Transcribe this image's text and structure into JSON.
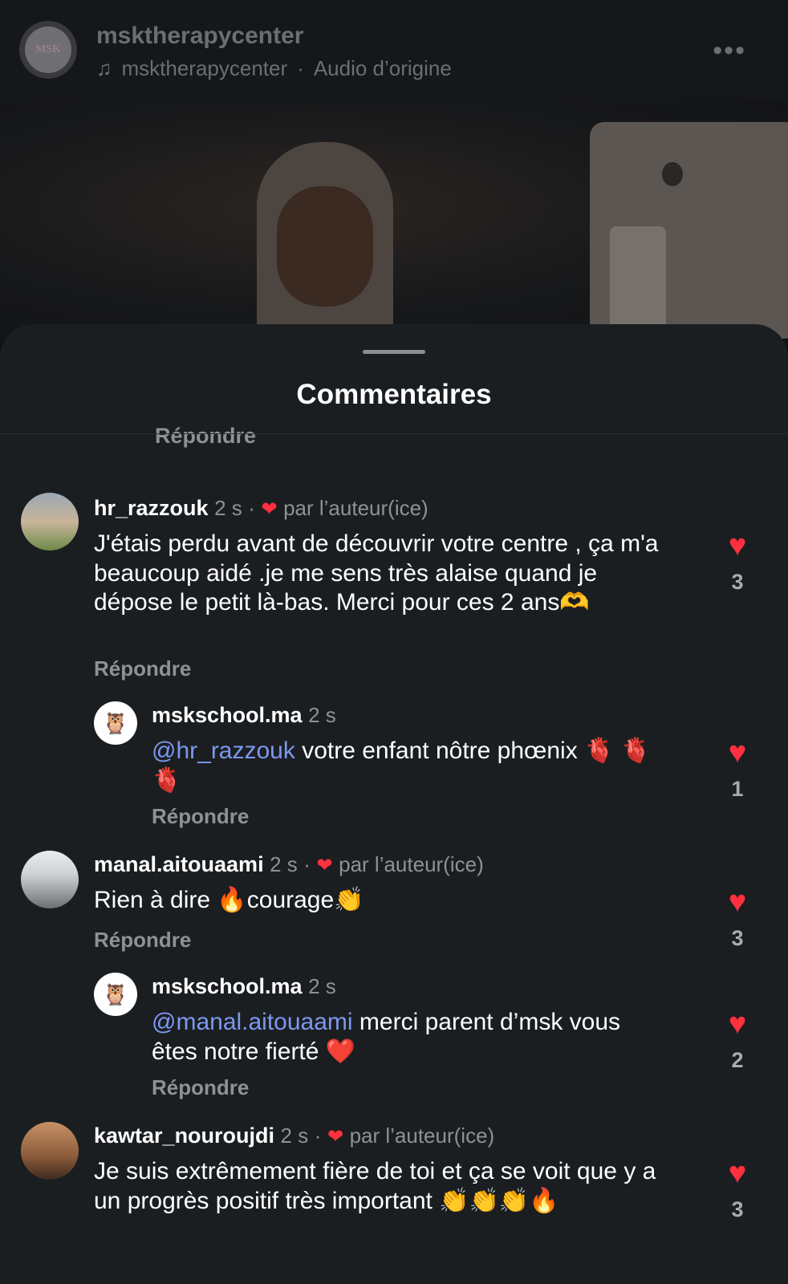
{
  "header": {
    "username": "msktherapycenter",
    "audio_user": "msktherapycenter",
    "audio_separator": "·",
    "audio_label": "Audio d’origine",
    "logo_text": "MSK",
    "more_icon": "more-horizontal-icon",
    "music_icon": "music-note-icon"
  },
  "sheet": {
    "title": "Commentaires",
    "clipped_reply": "Répondre"
  },
  "comments": [
    {
      "user": "hr_razzouk",
      "time": "2 s",
      "separator": "·",
      "liked_by_author": "par l’auteur(ice)",
      "text": "J'étais perdu avant de découvrir votre centre , ça m'a beaucoup aidé .je me sens très alaise quand je dépose le petit là-bas. Merci pour ces 2 ans🫶",
      "reply_label": "Répondre",
      "likes": "3"
    },
    {
      "user": "mskschool.ma",
      "time": "2 s",
      "mention": "@hr_razzouk",
      "text": " votre enfant nôtre phœnix 🫀 🫀 🫀",
      "reply_label": "Répondre",
      "likes": "1"
    },
    {
      "user": "manal.aitouaami",
      "time": "2 s",
      "separator": "·",
      "liked_by_author": "par l’auteur(ice)",
      "text": "Rien à dire 🔥courage👏",
      "reply_label": "Répondre",
      "likes": "3"
    },
    {
      "user": "mskschool.ma",
      "time": "2 s",
      "mention": "@manal.aitouaami",
      "text": "  merci parent d’msk vous êtes notre fierté ❤️",
      "reply_label": "Répondre",
      "likes": "2"
    },
    {
      "user": "kawtar_nouroujdi",
      "time": "2 s",
      "separator": "·",
      "liked_by_author": "par l’auteur(ice)",
      "text": "Je suis extrêmement fière de toi et ça se voit que y a un progrès  positif très important 👏👏👏🔥",
      "likes": "3"
    }
  ],
  "colors": {
    "background": "#101214",
    "sheet": "#1b1e21",
    "like_red": "#ff3040",
    "mention_blue": "#7c98ef",
    "muted_text": "#8e9196"
  }
}
